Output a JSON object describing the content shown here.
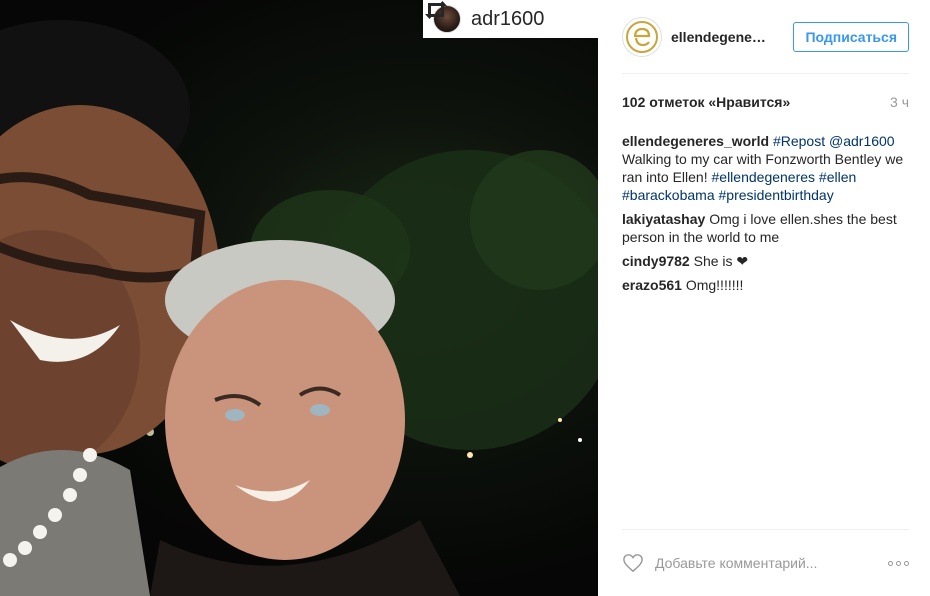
{
  "photo": {
    "description_icon": "photo",
    "repost": {
      "icon": "repost-icon",
      "username": "adr1600"
    }
  },
  "header": {
    "username": "ellendegeneres_world",
    "follow_label": "Подписаться"
  },
  "meta": {
    "likes": "102 отметок «Нравится»",
    "time": "3 ч"
  },
  "caption": {
    "username": "ellendegeneres_world",
    "repost_tag": "#Repost",
    "mention": "@adr1600",
    "text": "Walking to my car with Fonzworth Bentley we ran into Ellen!",
    "hashtags": [
      "#ellendegeneres",
      "#ellen",
      "#barackobama",
      "#presidentbirthday"
    ]
  },
  "comments": [
    {
      "username": "lakiyatashay",
      "text": "Omg i love ellen.shes the best person in the world to me"
    },
    {
      "username": "cindy9782",
      "text": "She is ❤"
    },
    {
      "username": "erazo561",
      "text": "Omg!!!!!!!"
    }
  ],
  "footer": {
    "comment_placeholder": "Добавьте комментарий..."
  },
  "colors": {
    "accent": "#3897f0",
    "link": "#003569",
    "muted": "#999999",
    "divider": "#efefef"
  }
}
